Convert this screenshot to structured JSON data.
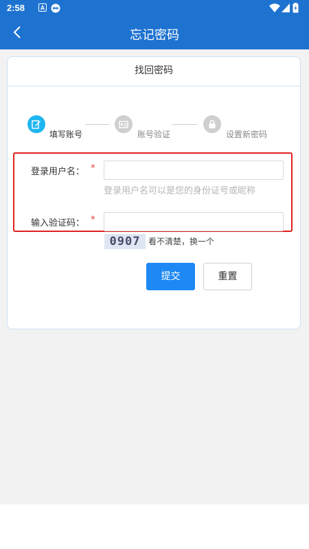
{
  "status_bar": {
    "time": "2:58",
    "icons": [
      "notification-a-icon",
      "infinity-icon",
      "wifi-icon",
      "signal-icon",
      "battery-icon"
    ]
  },
  "app_bar": {
    "title": "忘记密码",
    "back_icon": "chevron-left-icon"
  },
  "card": {
    "header": "找回密码",
    "steps": [
      {
        "label": "填写账号",
        "active": true,
        "icon": "edit-icon"
      },
      {
        "label": "账号验证",
        "active": false,
        "icon": "card-icon"
      },
      {
        "label": "设置新密码",
        "active": false,
        "icon": "lock-icon"
      }
    ],
    "form": {
      "username_label": "登录用户名：",
      "username_value": "",
      "username_hint": "登录用户名可以是您的身份证号或昵称",
      "captcha_label": "输入验证码：",
      "captcha_value": "",
      "required_mark": "*",
      "captcha_image_text": "0907",
      "captcha_refresh": "看不清楚，换一个"
    },
    "buttons": {
      "submit": "提交",
      "reset": "重置"
    }
  },
  "colors": {
    "primary": "#1e73d1",
    "button_primary": "#1e88f5",
    "step_active": "#1eb6f0",
    "step_inactive": "#cfcfcf",
    "required": "#e53935",
    "highlight": "#e02020"
  }
}
